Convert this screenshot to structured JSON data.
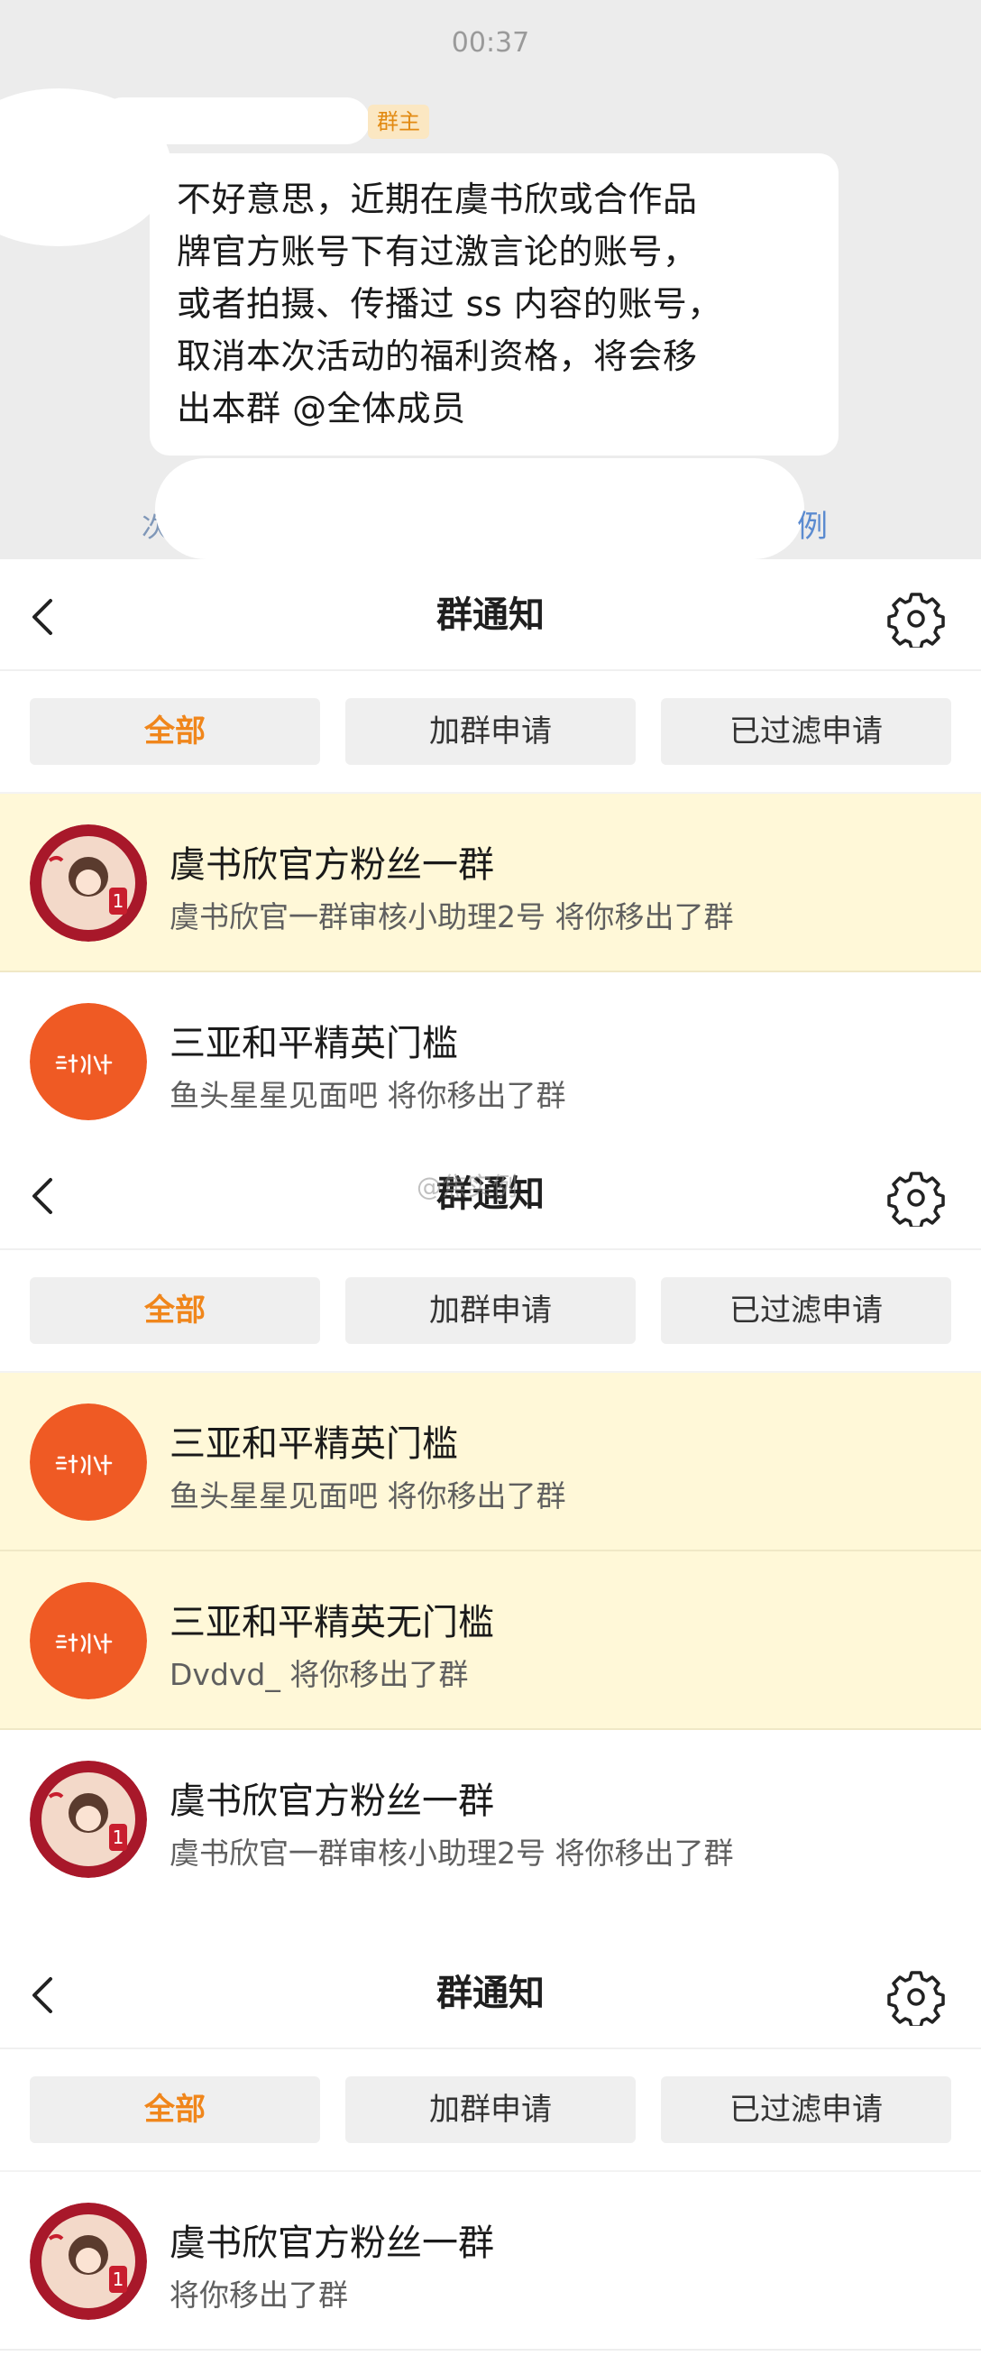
{
  "chat": {
    "time": "00:37",
    "owner_badge": "群主",
    "message_lines": [
      "不好意思，近期在虞书欣或合作品",
      "牌官方账号下有过激言论的账号，",
      "或者拍摄、传播过 ss 内容的账号，",
      "取消本次活动的福利资格，将会移",
      "出本群 @全体成员"
    ],
    "cut_left": "次",
    "cut_right": "例"
  },
  "watermark": "@焦实例",
  "panels": [
    {
      "title": "群通知",
      "tabs": [
        "全部",
        "加群申请",
        "已过滤申请"
      ],
      "items": [
        {
          "title": "虞书欣官方粉丝一群",
          "sub": "虞书欣官一群审核小助理2号 将你移出了群",
          "avatar": "yu-avatar-icon",
          "highlight": true
        },
        {
          "title": "三亚和平精英门槛",
          "sub": "鱼头星星见面吧 将你移出了群",
          "avatar": "orange-logo-icon",
          "highlight": false
        }
      ]
    },
    {
      "title": "群通知",
      "tabs": [
        "全部",
        "加群申请",
        "已过滤申请"
      ],
      "items": [
        {
          "title": "三亚和平精英门槛",
          "sub": "鱼头星星见面吧 将你移出了群",
          "avatar": "orange-logo-icon",
          "highlight": true
        },
        {
          "title": "三亚和平精英无门槛",
          "sub": "Dvdvd_ 将你移出了群",
          "avatar": "orange-logo-icon",
          "highlight": true
        },
        {
          "title": "虞书欣官方粉丝一群",
          "sub": "虞书欣官一群审核小助理2号 将你移出了群",
          "avatar": "yu-avatar-icon",
          "highlight": false
        }
      ]
    },
    {
      "title": "群通知",
      "tabs": [
        "全部",
        "加群申请",
        "已过滤申请"
      ],
      "items": [
        {
          "title": "虞书欣官方粉丝一群",
          "sub": "将你移出了群",
          "avatar": "yu-avatar-icon",
          "highlight": false
        }
      ]
    }
  ],
  "colors": {
    "accent_tab": "#f0861b",
    "highlight_row": "#fff8d8",
    "orange_avatar": "#ef5a24",
    "red_avatar": "#a8182a"
  }
}
